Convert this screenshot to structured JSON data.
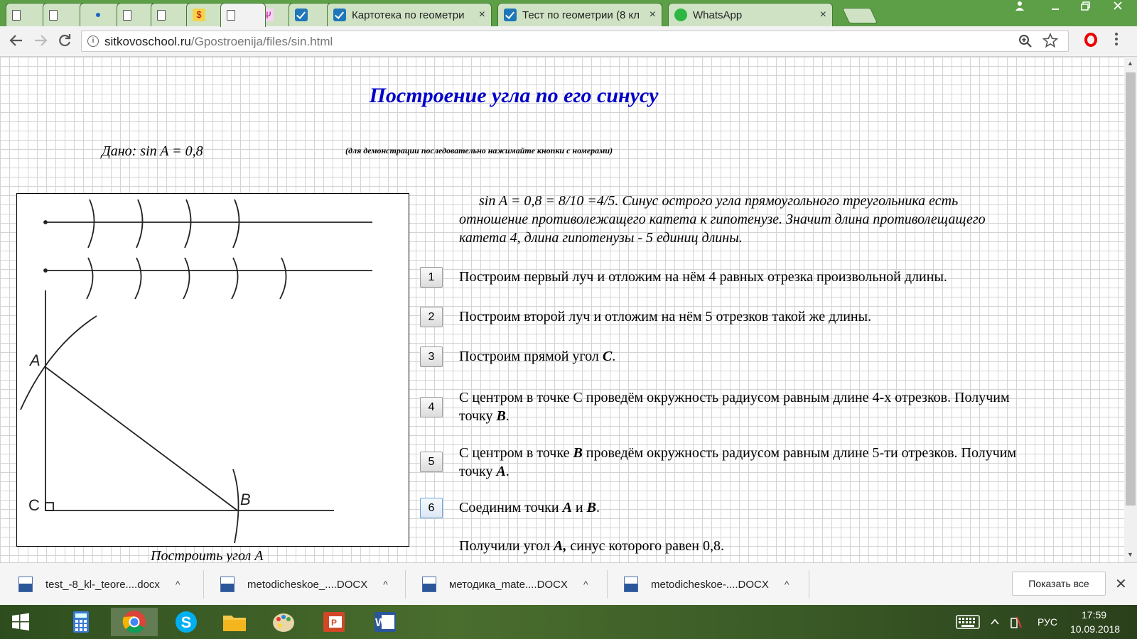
{
  "browser": {
    "tabs": [
      {
        "title": "",
        "icon": "document-icon"
      },
      {
        "title": "",
        "icon": "document-icon"
      },
      {
        "title": "",
        "icon": "loading-icon"
      },
      {
        "title": "",
        "icon": "document-icon"
      },
      {
        "title": "",
        "icon": "document-icon"
      },
      {
        "title": "",
        "icon": "yellow-app-icon"
      },
      {
        "title": "",
        "icon": "document-icon"
      },
      {
        "title": "",
        "icon": "pink-app-icon"
      },
      {
        "title": "",
        "icon": "check-icon"
      },
      {
        "title": "Картотека по геометри",
        "icon": "check-icon"
      },
      {
        "title": "Тест по геометрии (8 кл",
        "icon": "check-icon"
      },
      {
        "title": "WhatsApp",
        "icon": "whatsapp-icon"
      }
    ],
    "close_glyph": "×",
    "url_host": "sitkovoschool.ru",
    "url_path": "/Gpostroenija/files/sin.html",
    "info_glyph": "i"
  },
  "page": {
    "title": "Построение угла по его синусу",
    "given": "Дано: sin A = 0,8",
    "hint": "(для демонстрации последовательно нажимайте кнопки с номерами)",
    "intro": "sin A = 0,8 = 8/10 =4/5. Синус острого угла прямоугольного треугольника есть отношение противолежащего катета к гипотенузе. Значит длина противолещащего катета 4, длина гипотенузы - 5 единиц длины.",
    "caption": "Построить угол А",
    "figure_labels": {
      "a": "A",
      "b": "B",
      "c": "C"
    },
    "steps": [
      {
        "num": "1",
        "text": "Построим первый луч и отложим на нём 4 равных отрезка произвольной длины."
      },
      {
        "num": "2",
        "text": "Построим второй луч и отложим на нём 5 отрезков такой же длины."
      },
      {
        "num": "3",
        "pre": "Построим прямой угол ",
        "b1": "С",
        "post": "."
      },
      {
        "num": "4",
        "pre": "С центром в точке С проведём окружность радиусом равным длине 4-х отрезков. Получим точку ",
        "b1": "В",
        "post": "."
      },
      {
        "num": "5",
        "pre": "С центром в точке ",
        "b1": "В",
        "mid": " проведём окружность радиусом равным длине 5-ти отрезков. Получим точку ",
        "b2": "А",
        "post": "."
      },
      {
        "num": "6",
        "pre": "Соединим точки ",
        "b1": "А",
        "mid": " и ",
        "b2": "В",
        "post": "."
      }
    ],
    "result_pre": "Получили угол ",
    "result_bold": "А,",
    "result_post": " синус которого равен 0,8."
  },
  "downloads": {
    "items": [
      "test_-8_kl-_teore....docx",
      "metodicheskoe_....DOCX",
      "методика_mate....DOCX",
      "metodicheskoe-....DOCX"
    ],
    "caret": "^",
    "show_all": "Показать все",
    "close_glyph": "✕"
  },
  "taskbar": {
    "language": "РУС",
    "time": "17:59",
    "date": "10.09.2018"
  },
  "colors": {
    "title_blue": "#0000c8",
    "tab_strip_green": "#5d9f46",
    "opera_red": "#e00000"
  }
}
